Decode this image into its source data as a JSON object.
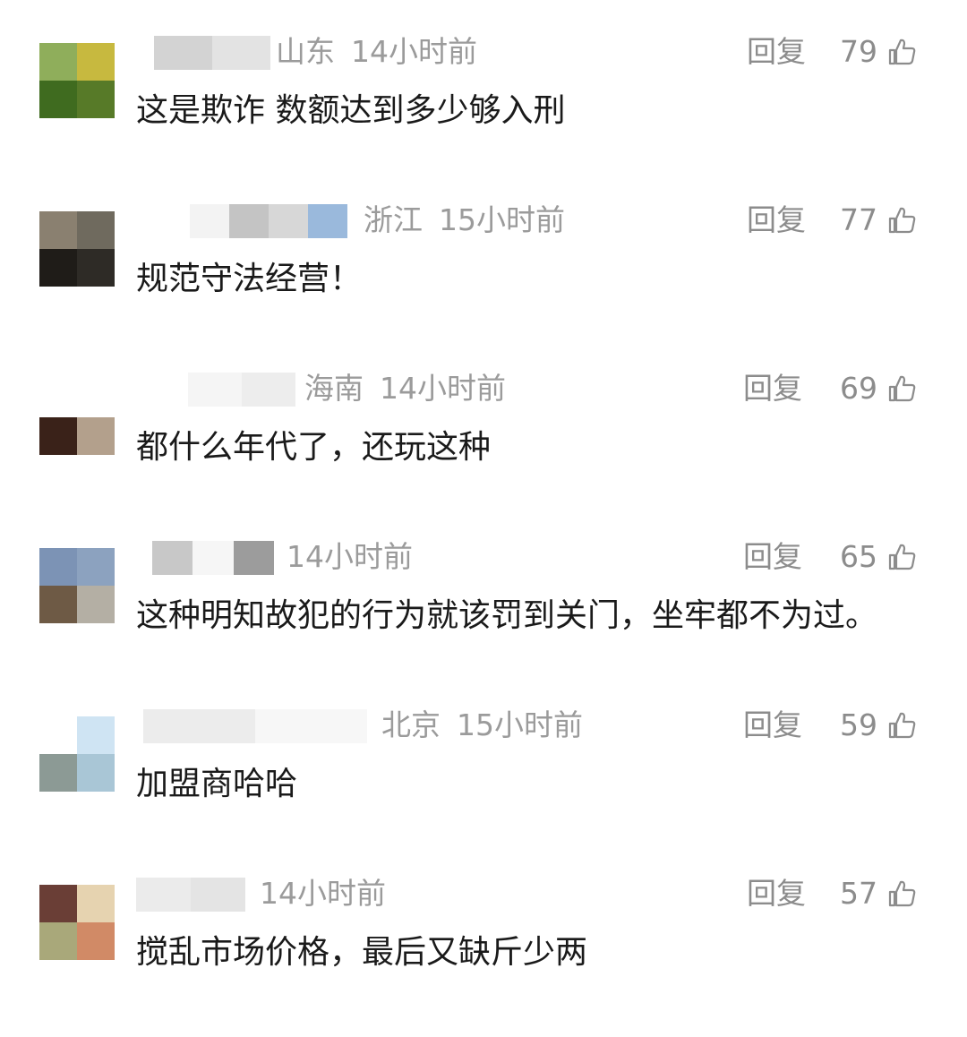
{
  "ui": {
    "reply_label": "回复",
    "like_icon": "thumbs-up-icon"
  },
  "comments": [
    {
      "region": "山东",
      "time": "14小时前",
      "likes": "79",
      "text": "这是欺诈 数额达到多少够入刑",
      "avatar_colors": [
        "#8fae5b",
        "#c7b93f",
        "#3f6b1f",
        "#577a28"
      ],
      "name_blur": [
        "#d3d3d3",
        "#e3e3e3"
      ]
    },
    {
      "region": "浙江",
      "time": "15小时前",
      "likes": "77",
      "text": "规范守法经营！",
      "avatar_colors": [
        "#8a8070",
        "#6f6a5e",
        "#1f1c18",
        "#2e2b26"
      ],
      "name_blur": [
        "#f3f3f3",
        "#c4c4c4",
        "#d7d7d7",
        "#9ab9dc"
      ]
    },
    {
      "region": "海南",
      "time": "14小时前",
      "likes": "69",
      "text": "都什么年代了，还玩这种",
      "avatar_colors": [
        "#ffffff",
        "#ffffff",
        "#3a2219",
        "#b3a08c"
      ],
      "name_blur": [
        "#f5f5f5",
        "#ededed"
      ]
    },
    {
      "region": "",
      "time": "14小时前",
      "likes": "65",
      "text": "这种明知故犯的行为就该罚到关门，坐牢都不为过。",
      "avatar_colors": [
        "#7c93b5",
        "#8ca2bf",
        "#6e5a45",
        "#b4afa4"
      ],
      "name_blur": [
        "#c8c8c8",
        "#f6f6f6",
        "#9c9c9c"
      ]
    },
    {
      "region": "北京",
      "time": "15小时前",
      "likes": "59",
      "text": "加盟商哈哈",
      "avatar_colors": [
        "#ffffff",
        "#cfe4f3",
        "#8c9a95",
        "#a9c6d6"
      ],
      "name_blur": [
        "#ececec",
        "#f7f7f7"
      ]
    },
    {
      "region": "",
      "time": "14小时前",
      "likes": "57",
      "text": "搅乱市场价格，最后又缺斤少两",
      "avatar_colors": [
        "#6a3e36",
        "#e6d3b0",
        "#a9a87a",
        "#d18a66"
      ],
      "name_blur": [
        "#ebebeb",
        "#e4e4e4"
      ]
    }
  ]
}
